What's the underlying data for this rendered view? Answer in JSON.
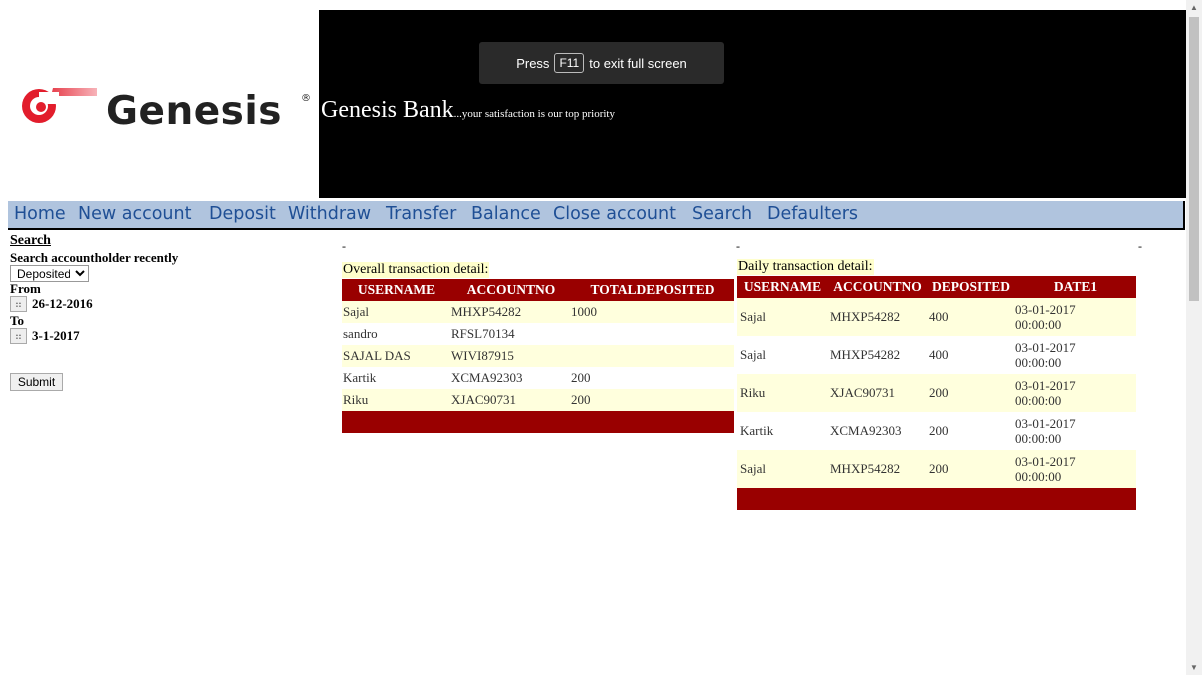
{
  "header": {
    "logo_text": "Genesis",
    "bank_name": "Genesis Bank",
    "tagline": "...your satisfaction is our top priority",
    "fullscreen_notice": {
      "prefix": "Press",
      "key": "F11",
      "suffix": "to exit full screen"
    }
  },
  "nav": [
    "Home",
    "New account",
    "Deposit",
    "Withdraw",
    "Transfer",
    "Balance",
    "Close account",
    "Search",
    "Defaulters"
  ],
  "search": {
    "title": "Search",
    "label": "Search accountholder recently",
    "select_value": "Deposited",
    "from_label": "From",
    "from_date": "26-12-2016",
    "to_label": "To",
    "to_date": "3-1-2017",
    "submit_label": "Submit"
  },
  "overall": {
    "caption": "Overall transaction detail:",
    "columns": [
      "USERNAME",
      "ACCOUNTNO",
      "TOTALDEPOSITED"
    ],
    "rows": [
      [
        "Sajal",
        "MHXP54282",
        "1000"
      ],
      [
        "sandro",
        "RFSL70134",
        ""
      ],
      [
        "SAJAL DAS",
        "WIVI87915",
        ""
      ],
      [
        "Kartik",
        "XCMA92303",
        "200"
      ],
      [
        "Riku",
        "XJAC90731",
        "200"
      ]
    ]
  },
  "daily": {
    "caption": "Daily transaction detail:",
    "columns": [
      "USERNAME",
      "ACCOUNTNO",
      "DEPOSITED",
      "DATE1"
    ],
    "rows": [
      [
        "Sajal",
        "MHXP54282",
        "400",
        "03-01-2017 00:00:00"
      ],
      [
        "Sajal",
        "MHXP54282",
        "400",
        "03-01-2017 00:00:00"
      ],
      [
        "Riku",
        "XJAC90731",
        "200",
        "03-01-2017 00:00:00"
      ],
      [
        "Kartik",
        "XCMA92303",
        "200",
        "03-01-2017 00:00:00"
      ],
      [
        "Sajal",
        "MHXP54282",
        "200",
        "03-01-2017 00:00:00"
      ]
    ]
  },
  "colors": {
    "header_bg": "#000000",
    "nav_bg": "#b0c4de",
    "nav_text": "#1f4f95",
    "table_header": "#990000",
    "row_highlight": "#ffffdd"
  }
}
